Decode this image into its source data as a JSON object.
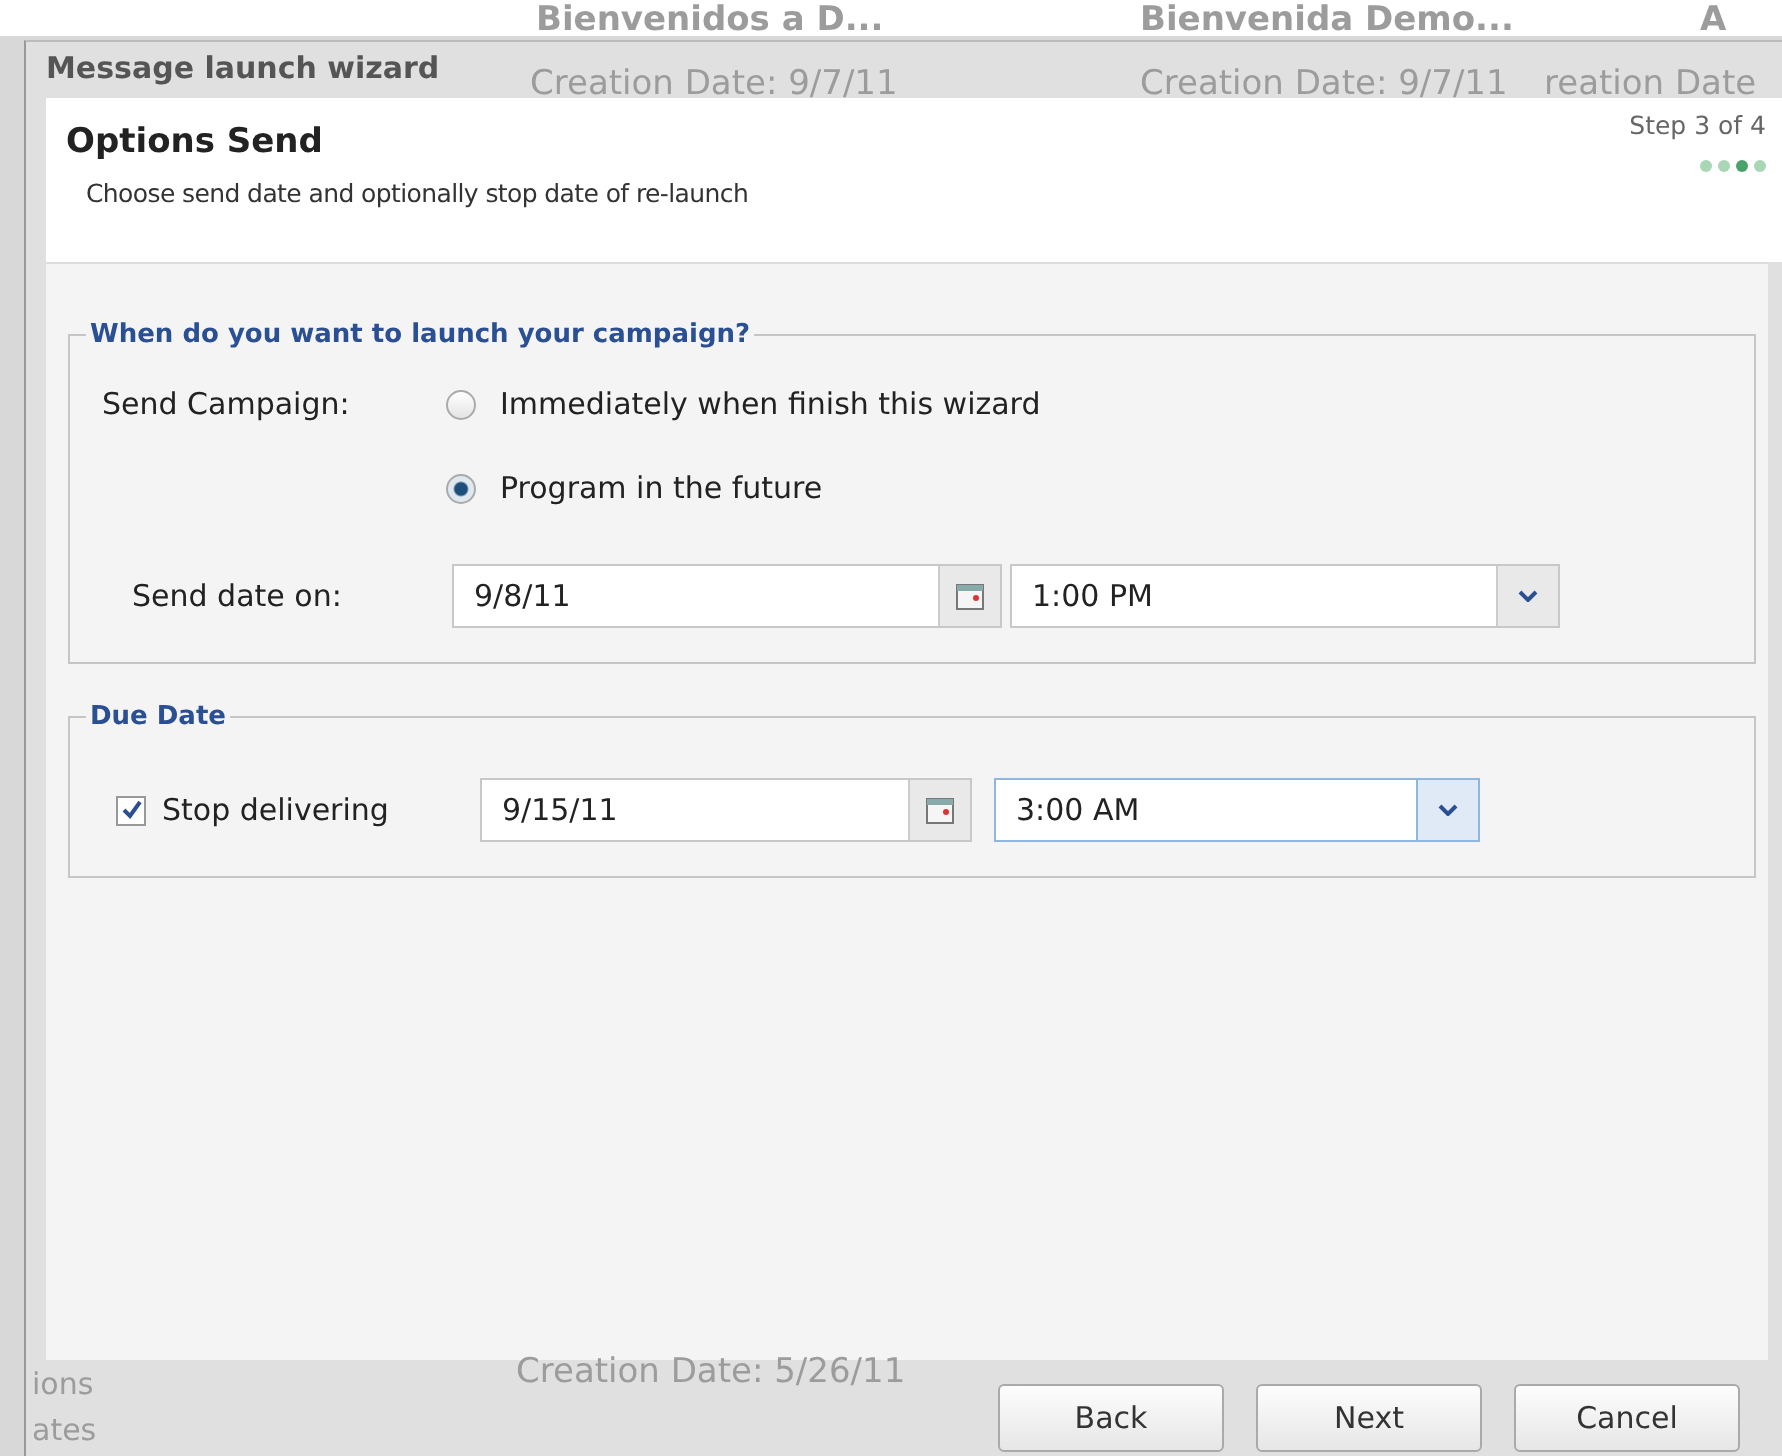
{
  "backdrop": {
    "titles": [
      "Bienvenidos a D...",
      "Bienvenida Demo...",
      "A"
    ],
    "dates": [
      "Creation Date: 9/7/11",
      "Creation Date: 9/7/11",
      "reation Date",
      "Creation Date: 5/26/11"
    ],
    "side": [
      "ions",
      "ates"
    ]
  },
  "window": {
    "title": "Message launch wizard"
  },
  "header": {
    "title": "Options Send",
    "subtitle": "Choose send date and optionally stop date of re-launch",
    "step": "Step 3 of 4",
    "steps": [
      {
        "selected": false
      },
      {
        "selected": false
      },
      {
        "selected": true
      },
      {
        "selected": false
      }
    ]
  },
  "launch": {
    "legend": "When do you want to launch your campaign?",
    "label": "Send Campaign:",
    "options": [
      {
        "label": "Immediately when finish this wizard",
        "selected": false
      },
      {
        "label": "Program in the future",
        "selected": true
      }
    ],
    "date_label": "Send date on:",
    "date": "9/8/11",
    "time": "1:00 PM"
  },
  "due": {
    "legend": "Due Date",
    "stop_label": "Stop delivering",
    "checked": true,
    "date": "9/15/11",
    "time": "3:00 AM"
  },
  "buttons": [
    "Back",
    "Next",
    "Cancel"
  ]
}
